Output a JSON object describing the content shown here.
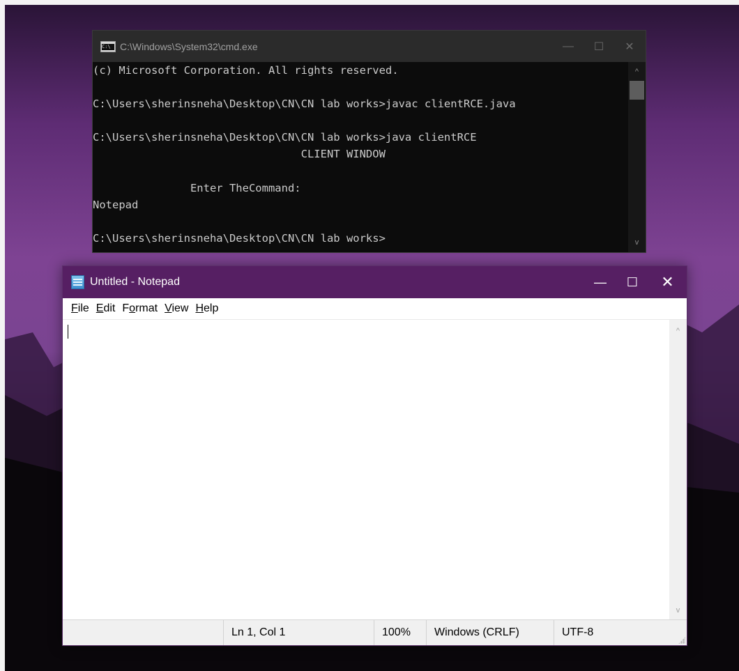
{
  "cmd": {
    "title": "C:\\Windows\\System32\\cmd.exe",
    "lines": [
      "(c) Microsoft Corporation. All rights reserved.",
      "",
      "C:\\Users\\sherinsneha\\Desktop\\CN\\CN lab works>javac clientRCE.java",
      "",
      "C:\\Users\\sherinsneha\\Desktop\\CN\\CN lab works>java clientRCE",
      "                                CLIENT WINDOW",
      "",
      "               Enter TheCommand:",
      "Notepad",
      "",
      "C:\\Users\\sherinsneha\\Desktop\\CN\\CN lab works>"
    ],
    "controls": {
      "minimize": "—",
      "maximize": "☐",
      "close": "✕"
    },
    "scroll_up": "^",
    "scroll_down": "v"
  },
  "notepad": {
    "title": "Untitled - Notepad",
    "controls": {
      "minimize": "—",
      "maximize": "☐",
      "close": "✕"
    },
    "menu": [
      {
        "key": "F",
        "rest": "ile"
      },
      {
        "key": "E",
        "rest": "dit"
      },
      {
        "pre": "F",
        "key": "o",
        "rest": "rmat"
      },
      {
        "key": "V",
        "rest": "iew"
      },
      {
        "key": "H",
        "rest": "elp"
      }
    ],
    "content": "",
    "scroll_up": "^",
    "scroll_down": "v",
    "status": {
      "position": "Ln 1, Col 1",
      "zoom": "100%",
      "line_ending": "Windows (CRLF)",
      "encoding": "UTF-8"
    }
  },
  "colors": {
    "notepad_titlebar": "#561f63",
    "cmd_background": "#0c0c0c",
    "cmd_text": "#cccccc"
  }
}
